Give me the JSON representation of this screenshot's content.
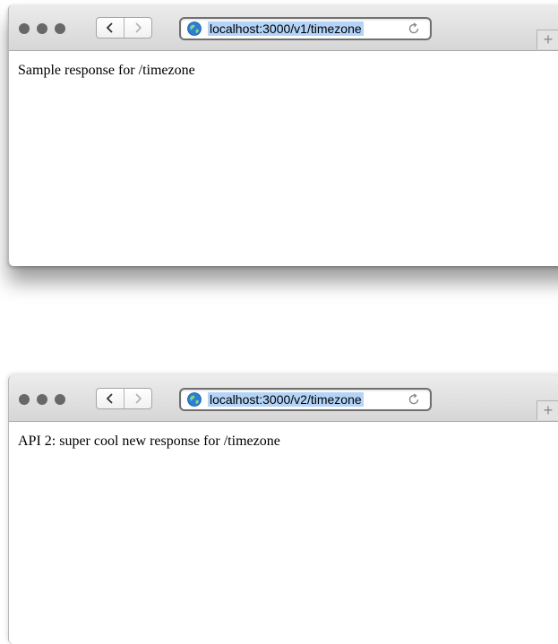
{
  "windows": [
    {
      "url": "localhost:3000/v1/timezone",
      "body_text": "Sample response for /timezone",
      "new_tab_label": "+"
    },
    {
      "url": "localhost:3000/v2/timezone",
      "body_text": "API 2: super cool new response for /timezone",
      "new_tab_label": "+"
    }
  ],
  "colors": {
    "url_selection": "#b3d3f7",
    "toolbar_top": "#ececec",
    "toolbar_bottom": "#d6d6d6",
    "traffic_light": "#686868"
  },
  "icons": [
    "globe-icon",
    "reload-icon",
    "chevron-left-icon",
    "chevron-right-icon",
    "plus-icon"
  ]
}
